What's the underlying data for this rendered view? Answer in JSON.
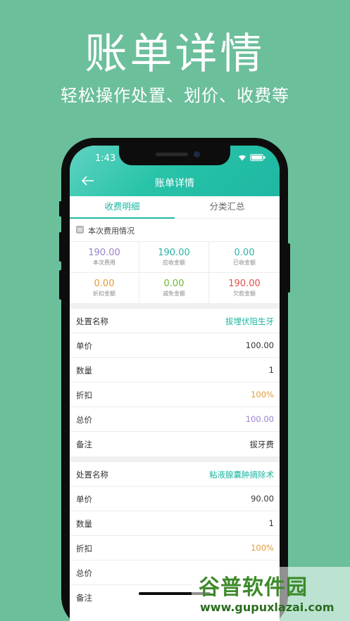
{
  "promo": {
    "title": "账单详情",
    "subtitle": "轻松操作处置、划价、收费等"
  },
  "status_bar": {
    "time": "1:43"
  },
  "nav": {
    "title": "账单详情",
    "back_icon": "arrow-left-icon"
  },
  "tabs": [
    {
      "label": "收费明细",
      "active": true
    },
    {
      "label": "分类汇总",
      "active": false
    }
  ],
  "summary": {
    "header": "本次费用情况",
    "cells": [
      {
        "value": "190.00",
        "caption": "本次费用",
        "color": "#9b7fd1"
      },
      {
        "value": "190.00",
        "caption": "应收金额",
        "color": "#2cb5a5"
      },
      {
        "value": "0.00",
        "caption": "已收金额",
        "color": "#2cb5a5"
      },
      {
        "value": "0.00",
        "caption": "折扣金额",
        "color": "#e59a34"
      },
      {
        "value": "0.00",
        "caption": "减免金额",
        "color": "#6ab936"
      },
      {
        "value": "190.00",
        "caption": "欠款金额",
        "color": "#e2504b"
      }
    ]
  },
  "items": [
    {
      "name_label": "处置名称",
      "name": "拔埋伏阻生牙",
      "price_label": "单价",
      "price": "100.00",
      "qty_label": "数量",
      "qty": "1",
      "discount_label": "折扣",
      "discount": "100%",
      "total_label": "总价",
      "total": "100.00",
      "note_label": "备注",
      "note": "拔牙费"
    },
    {
      "name_label": "处置名称",
      "name": "粘液腺囊肿摘除术",
      "price_label": "单价",
      "price": "90.00",
      "qty_label": "数量",
      "qty": "1",
      "discount_label": "折扣",
      "discount": "100%",
      "total_label": "总价",
      "total": "",
      "note_label": "备注"
    }
  ],
  "watermark": {
    "brand": "谷普软件园",
    "url": "www.gupuxlazai.com"
  },
  "colors": {
    "background": "#6bbf9b",
    "accent": "#1fb7a2",
    "discount": "#e59a34",
    "total": "#9b7fd1"
  }
}
